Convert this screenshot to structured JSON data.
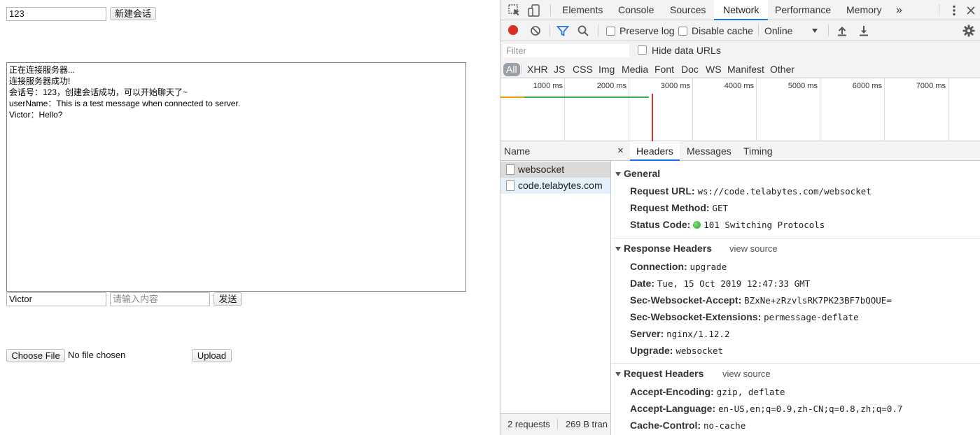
{
  "page": {
    "session_input": "123",
    "new_session_button": "新建会话",
    "log_lines": [
      "正在连接服务器...",
      "连接服务器成功!",
      "会话号：123，创建会话成功，可以开始聊天了~",
      "userName：This is a test message when connected to server.",
      "Victor：Hello?"
    ],
    "name_input": "Victor",
    "message_placeholder": "请输入内容",
    "send_button": "发送",
    "choose_file_button": "Choose File",
    "no_file_text": "No file chosen",
    "upload_button": "Upload"
  },
  "devtools": {
    "tabs": [
      "Elements",
      "Console",
      "Sources",
      "Network",
      "Performance",
      "Memory"
    ],
    "more_tabs": "»",
    "active_tab": "Network",
    "toolbar": {
      "preserve_log": "Preserve log",
      "disable_cache": "Disable cache",
      "throttle": "Online"
    },
    "filter_placeholder": "Filter",
    "hide_data_urls": "Hide data URLs",
    "filter_types": [
      "All",
      "XHR",
      "JS",
      "CSS",
      "Img",
      "Media",
      "Font",
      "Doc",
      "WS",
      "Manifest",
      "Other"
    ],
    "timeline_ticks": [
      "1000 ms",
      "2000 ms",
      "3000 ms",
      "4000 ms",
      "5000 ms",
      "6000 ms",
      "7000 ms"
    ],
    "name_header": "Name",
    "requests": [
      "websocket",
      "code.telabytes.com"
    ],
    "footer_count": "2 requests",
    "footer_transfer": "269 B tran",
    "detail_tabs": [
      "Headers",
      "Messages",
      "Timing"
    ],
    "close_glyph": "×",
    "general": {
      "title": "General",
      "request_url_key": "Request URL:",
      "request_url": "ws://code.telabytes.com/websocket",
      "request_method_key": "Request Method:",
      "request_method": "GET",
      "status_code_key": "Status Code:",
      "status_code": "101 Switching Protocols"
    },
    "response_headers": {
      "title": "Response Headers",
      "view_source": "view source",
      "rows": [
        {
          "key": "Connection:",
          "value": "upgrade"
        },
        {
          "key": "Date:",
          "value": "Tue, 15 Oct 2019 12:47:33 GMT"
        },
        {
          "key": "Sec-Websocket-Accept:",
          "value": "BZxNe+zRzvlsRK7PK23BF7bQOUE="
        },
        {
          "key": "Sec-Websocket-Extensions:",
          "value": "permessage-deflate"
        },
        {
          "key": "Server:",
          "value": "nginx/1.12.2"
        },
        {
          "key": "Upgrade:",
          "value": "websocket"
        }
      ]
    },
    "request_headers": {
      "title": "Request Headers",
      "view_source": "view source",
      "rows": [
        {
          "key": "Accept-Encoding:",
          "value": "gzip, deflate"
        },
        {
          "key": "Accept-Language:",
          "value": "en-US,en;q=0.9,zh-CN;q=0.8,zh;q=0.7"
        },
        {
          "key": "Cache-Control:",
          "value": "no-cache"
        }
      ]
    },
    "colors": {
      "record": "#d93025",
      "accent": "#1a73e8",
      "status_ok": "#1ea81e",
      "load_line": "#d93025",
      "dom_line": "#4a7bd6"
    }
  }
}
